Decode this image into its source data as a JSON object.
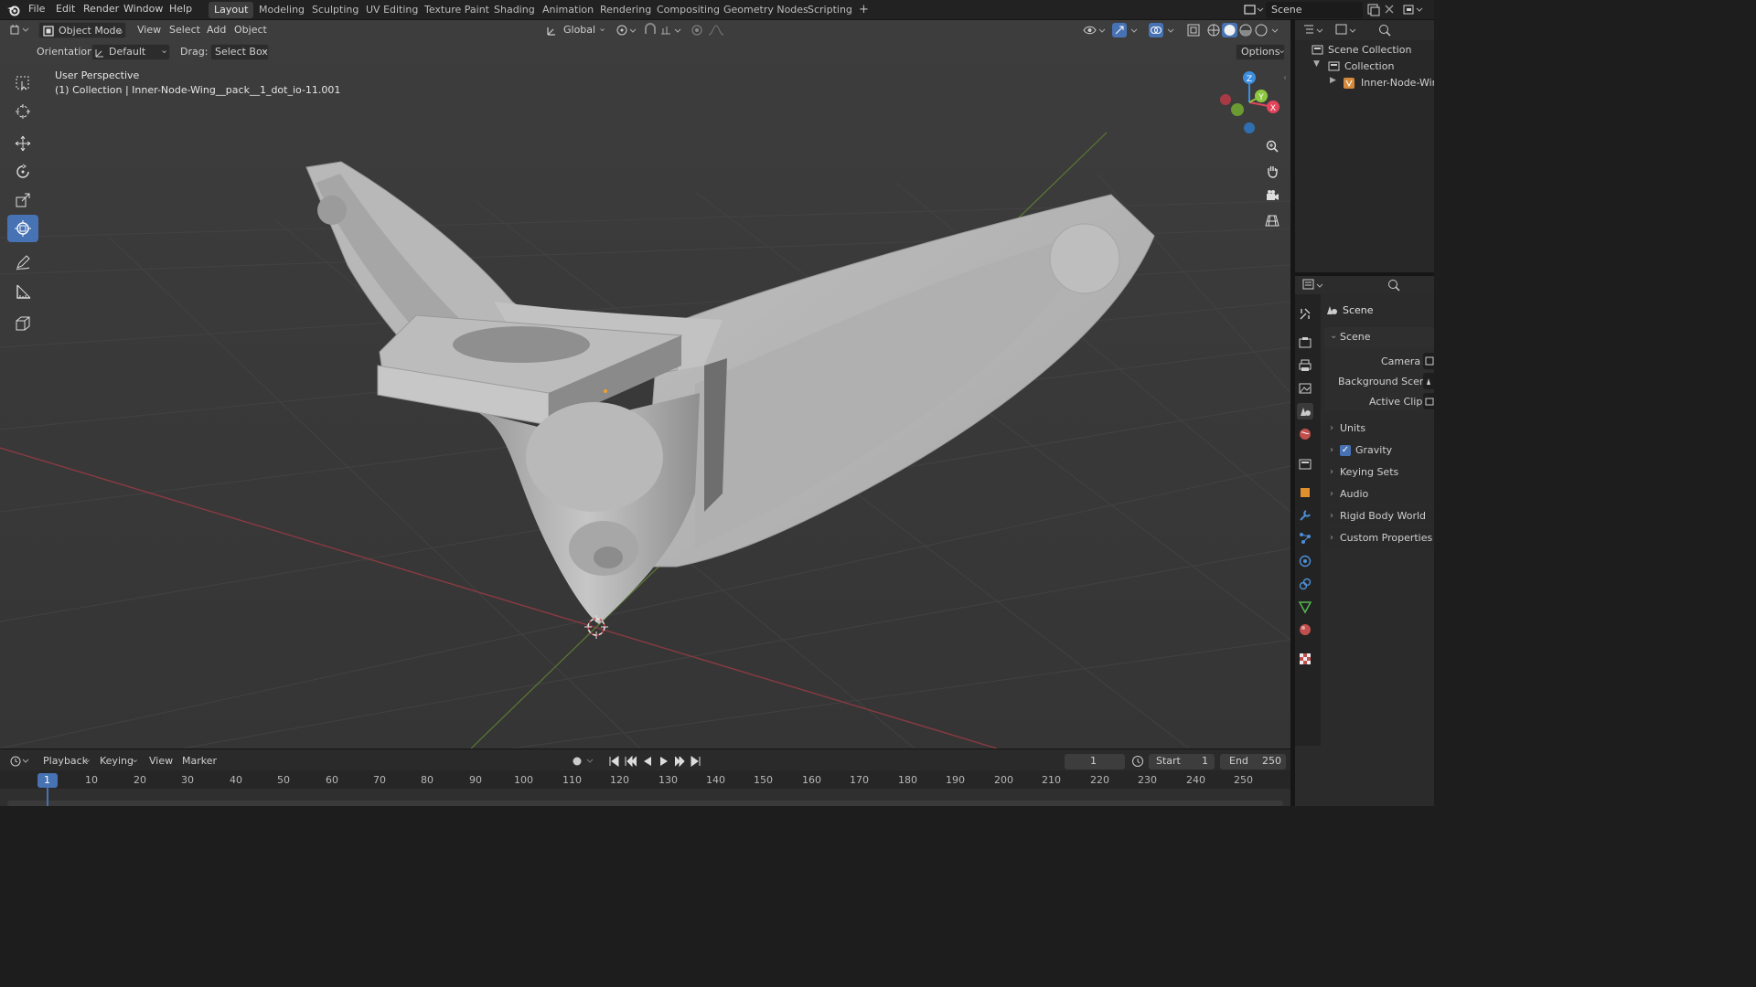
{
  "topbar": {
    "menus": [
      "File",
      "Edit",
      "Render",
      "Window",
      "Help"
    ],
    "workspaces": [
      "Layout",
      "Modeling",
      "Sculpting",
      "UV Editing",
      "Texture Paint",
      "Shading",
      "Animation",
      "Rendering",
      "Compositing",
      "Geometry Nodes",
      "Scripting"
    ],
    "active_workspace": "Layout",
    "add_tab": "+",
    "scene_name": "Scene"
  },
  "viewport_header": {
    "mode": "Object Mode",
    "menus": [
      "View",
      "Select",
      "Add",
      "Object"
    ],
    "transform_orientation": "Global"
  },
  "tool_settings": {
    "orientation_label": "Orientation:",
    "orientation_value": "Default",
    "drag_label": "Drag:",
    "drag_value": "Select Box",
    "options_label": "Options"
  },
  "viewport_overlay": {
    "perspective": "User Perspective",
    "object_info": "(1) Collection | Inner-Node-Wing__pack__1_dot_io-11.001"
  },
  "gizmo": {
    "x": "X",
    "y": "Y",
    "z": "Z"
  },
  "outliner": {
    "root": "Scene Collection",
    "collection": "Collection",
    "object": "Inner-Node-Wing_"
  },
  "properties": {
    "context_title": "Scene",
    "panel_title": "Scene",
    "camera_label": "Camera",
    "background_scene_label": "Background Scene",
    "active_clip_label": "Active Clip",
    "panels": [
      {
        "label": "Units",
        "checkbox": false
      },
      {
        "label": "Gravity",
        "checkbox": true,
        "checked": true
      },
      {
        "label": "Keying Sets",
        "checkbox": false
      },
      {
        "label": "Audio",
        "checkbox": false
      },
      {
        "label": "Rigid Body World",
        "checkbox": false
      },
      {
        "label": "Custom Properties",
        "checkbox": false
      }
    ]
  },
  "timeline": {
    "menus": [
      "Playback",
      "Keying",
      "View",
      "Marker"
    ],
    "current_frame": "1",
    "start_label": "Start",
    "start_value": "1",
    "end_label": "End",
    "end_value": "250",
    "ruler_ticks": [
      "10",
      "20",
      "30",
      "40",
      "50",
      "60",
      "70",
      "80",
      "90",
      "100",
      "110",
      "120",
      "130",
      "140",
      "150",
      "160",
      "170",
      "180",
      "190",
      "200",
      "210",
      "220",
      "230",
      "240",
      "250"
    ],
    "playhead_label": "1"
  },
  "colors": {
    "accent": "#4772b3",
    "axis_x": "#e0455a",
    "axis_y": "#8dc63f",
    "axis_z": "#3b8ee0",
    "model": "#b5b5b5"
  }
}
